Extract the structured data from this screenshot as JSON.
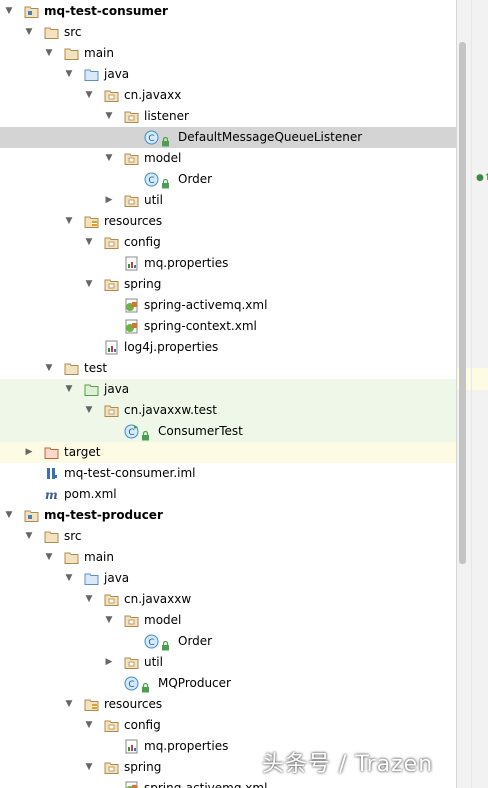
{
  "tree": [
    {
      "label": "mq-test-consumer",
      "icon": "module-folder-icon",
      "depth": 0,
      "arrow": "open",
      "bold": true
    },
    {
      "label": "src",
      "icon": "folder-icon",
      "depth": 1,
      "arrow": "open"
    },
    {
      "label": "main",
      "icon": "folder-icon",
      "depth": 2,
      "arrow": "open"
    },
    {
      "label": "java",
      "icon": "source-root-folder-icon",
      "depth": 3,
      "arrow": "open"
    },
    {
      "label": "cn.javaxx",
      "icon": "package-icon",
      "depth": 4,
      "arrow": "open"
    },
    {
      "label": "listener",
      "icon": "package-icon",
      "depth": 5,
      "arrow": "open"
    },
    {
      "label": "DefaultMessageQueueListener",
      "icon": "class-icon",
      "depth": 6,
      "arrow": "none",
      "state": "selected"
    },
    {
      "label": "model",
      "icon": "package-icon",
      "depth": 5,
      "arrow": "open"
    },
    {
      "label": "Order",
      "icon": "class-icon",
      "depth": 6,
      "arrow": "none"
    },
    {
      "label": "util",
      "icon": "package-icon",
      "depth": 5,
      "arrow": "closed"
    },
    {
      "label": "resources",
      "icon": "resources-folder-icon",
      "depth": 3,
      "arrow": "open"
    },
    {
      "label": "config",
      "icon": "package-icon",
      "depth": 4,
      "arrow": "open"
    },
    {
      "label": "mq.properties",
      "icon": "properties-file-icon",
      "depth": 5,
      "arrow": "none"
    },
    {
      "label": "spring",
      "icon": "package-icon",
      "depth": 4,
      "arrow": "open"
    },
    {
      "label": "spring-activemq.xml",
      "icon": "spring-xml-icon",
      "depth": 5,
      "arrow": "none"
    },
    {
      "label": "spring-context.xml",
      "icon": "spring-xml-icon",
      "depth": 5,
      "arrow": "none"
    },
    {
      "label": "log4j.properties",
      "icon": "properties-file-icon",
      "depth": 4,
      "arrow": "none"
    },
    {
      "label": "test",
      "icon": "folder-icon",
      "depth": 2,
      "arrow": "open"
    },
    {
      "label": "java",
      "icon": "test-root-folder-icon",
      "depth": 3,
      "arrow": "open",
      "state": "test"
    },
    {
      "label": "cn.javaxxw.test",
      "icon": "package-icon",
      "depth": 4,
      "arrow": "open",
      "state": "test"
    },
    {
      "label": "ConsumerTest",
      "icon": "test-class-icon",
      "depth": 5,
      "arrow": "none",
      "state": "test"
    },
    {
      "label": "target",
      "icon": "excluded-folder-icon",
      "depth": 1,
      "arrow": "closed",
      "state": "excluded"
    },
    {
      "label": "mq-test-consumer.iml",
      "icon": "iml-file-icon",
      "depth": 1,
      "arrow": "none"
    },
    {
      "label": "pom.xml",
      "icon": "maven-file-icon",
      "depth": 1,
      "arrow": "none"
    },
    {
      "label": "mq-test-producer",
      "icon": "module-folder-icon",
      "depth": 0,
      "arrow": "open",
      "bold": true
    },
    {
      "label": "src",
      "icon": "folder-icon",
      "depth": 1,
      "arrow": "open"
    },
    {
      "label": "main",
      "icon": "folder-icon",
      "depth": 2,
      "arrow": "open"
    },
    {
      "label": "java",
      "icon": "source-root-folder-icon",
      "depth": 3,
      "arrow": "open"
    },
    {
      "label": "cn.javaxxw",
      "icon": "package-icon",
      "depth": 4,
      "arrow": "open"
    },
    {
      "label": "model",
      "icon": "package-icon",
      "depth": 5,
      "arrow": "open"
    },
    {
      "label": "Order",
      "icon": "class-icon",
      "depth": 6,
      "arrow": "none"
    },
    {
      "label": "util",
      "icon": "package-icon",
      "depth": 5,
      "arrow": "closed"
    },
    {
      "label": "MQProducer",
      "icon": "class-icon",
      "depth": 5,
      "arrow": "none"
    },
    {
      "label": "resources",
      "icon": "resources-folder-icon",
      "depth": 3,
      "arrow": "open"
    },
    {
      "label": "config",
      "icon": "package-icon",
      "depth": 4,
      "arrow": "open"
    },
    {
      "label": "mq.properties",
      "icon": "properties-file-icon",
      "depth": 5,
      "arrow": "none"
    },
    {
      "label": "spring",
      "icon": "package-icon",
      "depth": 4,
      "arrow": "open"
    },
    {
      "label": "spring-activemq.xml",
      "icon": "spring-xml-icon",
      "depth": 5,
      "arrow": "none"
    }
  ],
  "watermark": "头条号 / Trazen",
  "colors": {
    "selected": "#d4d4d4",
    "test_bg": "#eef7e8",
    "excluded_bg": "#fdfbe4",
    "folder": "#c9a36a",
    "source_root": "#6aa6d6",
    "test_root": "#5fa34c",
    "excluded": "#cc6a4a",
    "class": "#3d8ec9"
  }
}
